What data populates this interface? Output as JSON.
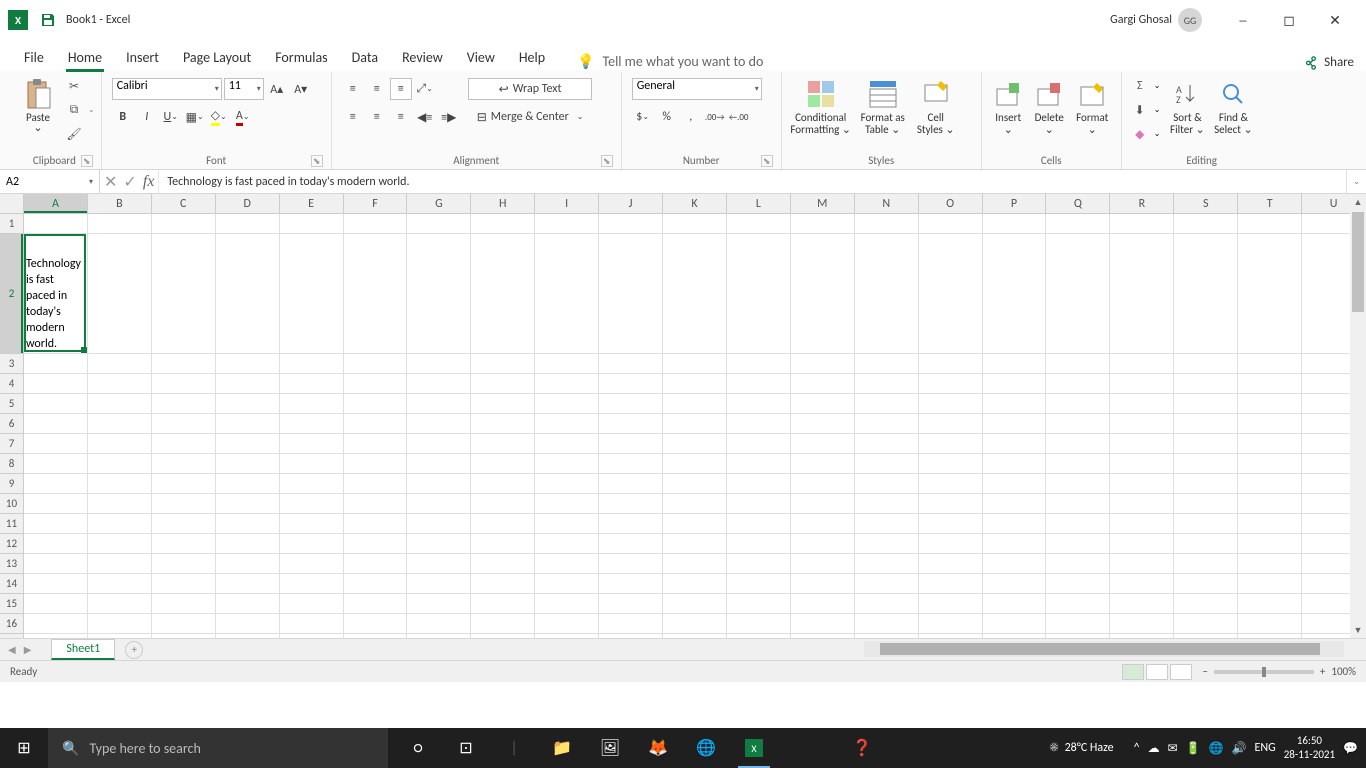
{
  "title": {
    "filename": "Book1  -  Excel",
    "user": "Gargi Ghosal",
    "initials": "GG"
  },
  "tabs": {
    "file": "File",
    "home": "Home",
    "insert": "Insert",
    "page": "Page Layout",
    "formulas": "Formulas",
    "data": "Data",
    "review": "Review",
    "view": "View",
    "help": "Help",
    "tellme": "Tell me what you want to do",
    "share": "Share"
  },
  "ribbon": {
    "clipboard": {
      "paste": "Paste",
      "label": "Clipboard"
    },
    "font": {
      "name": "Calibri",
      "size": "11",
      "label": "Font"
    },
    "alignment": {
      "wrap": "Wrap Text",
      "merge": "Merge & Center",
      "label": "Alignment"
    },
    "number": {
      "format": "General",
      "label": "Number"
    },
    "styles": {
      "cond": "Conditional",
      "cond2": "Formatting",
      "fat": "Format as",
      "fat2": "Table",
      "cell": "Cell",
      "cell2": "Styles",
      "label": "Styles"
    },
    "cells": {
      "insert": "Insert",
      "delete": "Delete",
      "format": "Format",
      "label": "Cells"
    },
    "editing": {
      "sort": "Sort &",
      "sort2": "Filter",
      "find": "Find &",
      "find2": "Select",
      "label": "Editing"
    }
  },
  "formulabar": {
    "ref": "A2",
    "formula": "Technology is fast paced in today's modern world."
  },
  "grid": {
    "cols": [
      "A",
      "B",
      "C",
      "D",
      "E",
      "F",
      "G",
      "H",
      "I",
      "J",
      "K",
      "L",
      "M",
      "N",
      "O",
      "P",
      "Q",
      "R",
      "S",
      "T",
      "U"
    ],
    "a2": "Technology is fast paced in today's modern world."
  },
  "sheet": {
    "name": "Sheet1"
  },
  "status": {
    "ready": "Ready",
    "zoom": "100%"
  },
  "taskbar": {
    "search": "Type here to search",
    "weather": "28°C  Haze",
    "lang": "ENG",
    "time": "16:50",
    "date": "28-11-2021"
  }
}
